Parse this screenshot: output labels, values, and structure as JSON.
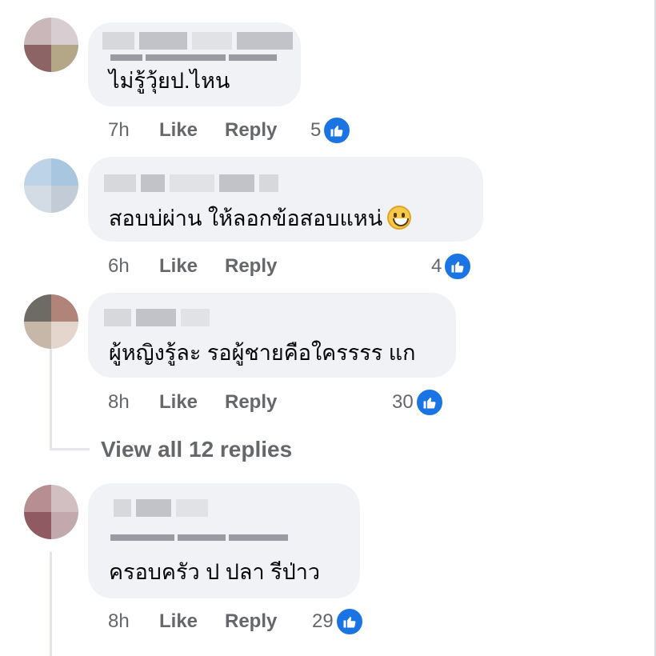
{
  "colors": {
    "bubble": "#f0f2f5",
    "secondary_text": "#65676b",
    "like_blue": "#1b74e4"
  },
  "comments": [
    {
      "text": "ไม่รู้วุ้ยป.ไหน",
      "time": "7h",
      "like_label": "Like",
      "reply_label": "Reply",
      "reaction_count": "5"
    },
    {
      "text": "สอบบ่ผ่าน ให้ลอกข้อสอบแหน่",
      "emoji": "grinning-face-icon",
      "time": "6h",
      "like_label": "Like",
      "reply_label": "Reply",
      "reaction_count": "4"
    },
    {
      "text": "ผู้หญิงรู้ละ รอผู้ชายคือใครรรร แก",
      "time": "8h",
      "like_label": "Like",
      "reply_label": "Reply",
      "reaction_count": "30"
    },
    {
      "text": "ครอบครัว ป ปลา รีป่าว",
      "time": "8h",
      "like_label": "Like",
      "reply_label": "Reply",
      "reaction_count": "29"
    }
  ],
  "view_replies_label": "View all 12 replies"
}
